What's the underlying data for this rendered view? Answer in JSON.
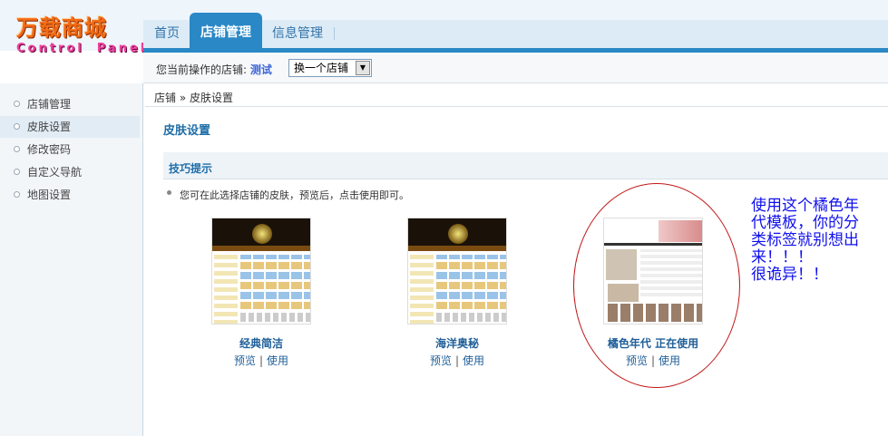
{
  "logo": {
    "line1": "万载商城",
    "line2a": "Control",
    "line2b": "Panel"
  },
  "nav": {
    "home": "首页",
    "shop": "店铺管理",
    "info": "信息管理"
  },
  "current_shop": {
    "label": "您当前操作的店铺:",
    "name": "测试",
    "switch_select": "换一个店铺"
  },
  "sidebar": {
    "items": [
      {
        "label": "店铺管理"
      },
      {
        "label": "皮肤设置"
      },
      {
        "label": "修改密码"
      },
      {
        "label": "自定义导航"
      },
      {
        "label": "地图设置"
      }
    ]
  },
  "breadcrumb": "店铺 » 皮肤设置",
  "page_title": "皮肤设置",
  "tips": {
    "title": "技巧提示",
    "text": "您可在此选择店铺的皮肤，预览后，点击使用即可。"
  },
  "skins": [
    {
      "name": "经典简洁",
      "preview": "预览",
      "use": "使用"
    },
    {
      "name": "海洋奥秘",
      "preview": "预览",
      "use": "使用"
    },
    {
      "name": "橘色年代 正在使用",
      "preview": "预览",
      "use": "使用"
    }
  ],
  "annotation": {
    "lines": [
      "使用这个橘色年",
      "代模板，你的分",
      "类标签就别想出",
      "来！！！",
      "很诡异！！"
    ]
  },
  "colors": {
    "accent": "#2a88c6",
    "annotation_text": "#1010ee",
    "annotation_circle": "#c01818"
  }
}
